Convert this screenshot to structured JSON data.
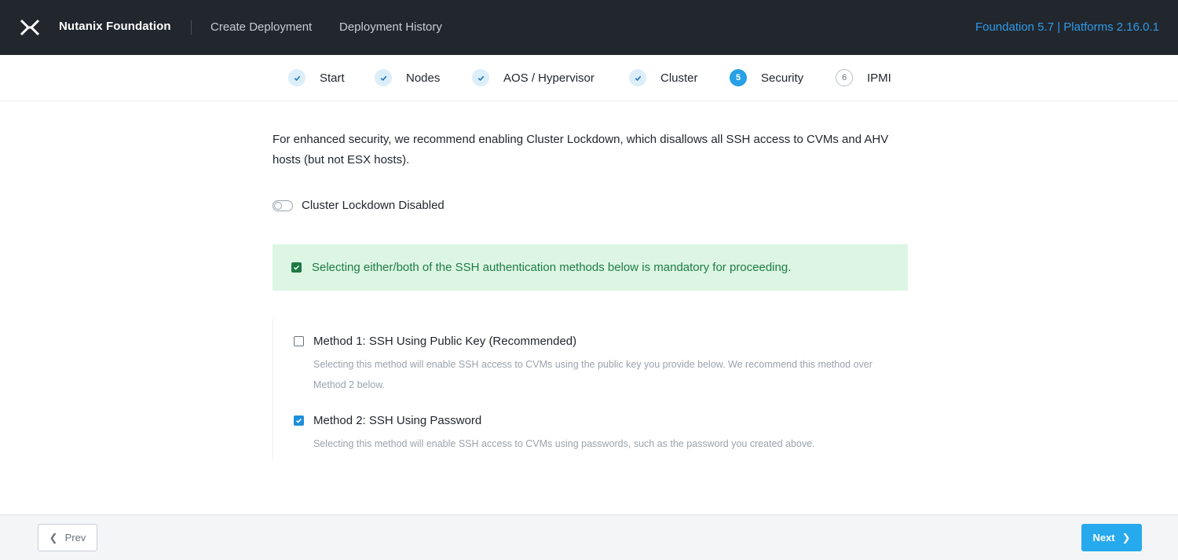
{
  "header": {
    "logo_icon": "nutanix-x-logo-icon",
    "brand": "Nutanix Foundation",
    "nav": {
      "create": "Create Deployment",
      "history": "Deployment History"
    },
    "version": "Foundation 5.7 | Platforms 2.16.0.1"
  },
  "steps": [
    {
      "label": "Start",
      "state": "done",
      "marker": ""
    },
    {
      "label": "Nodes",
      "state": "done",
      "marker": ""
    },
    {
      "label": "AOS / Hypervisor",
      "state": "done",
      "marker": ""
    },
    {
      "label": "Cluster",
      "state": "done",
      "marker": ""
    },
    {
      "label": "Security",
      "state": "active",
      "marker": "5"
    },
    {
      "label": "IPMI",
      "state": "todo",
      "marker": "6"
    }
  ],
  "content": {
    "intro": "For enhanced security, we recommend enabling Cluster Lockdown, which disallows all SSH access to CVMs and AHV hosts (but not ESX hosts).",
    "lockdown_toggle": {
      "label": "Cluster Lockdown Disabled",
      "on": false
    },
    "notice": "Selecting either/both of the SSH authentication methods below is mandatory for proceeding.",
    "methods": [
      {
        "title": "Method 1: SSH Using Public Key (Recommended)",
        "desc": "Selecting this method will enable SSH access to CVMs using the public key you provide below. We recommend this method over Method 2 below.",
        "checked": false
      },
      {
        "title": "Method 2: SSH Using Password",
        "desc": "Selecting this method will enable SSH access to CVMs using passwords, such as the password you created above.",
        "checked": true
      }
    ]
  },
  "footer": {
    "prev": "Prev",
    "next": "Next"
  },
  "colors": {
    "header_bg": "#22272e",
    "accent": "#27a9ee",
    "version": "#2e9be8",
    "notice_bg": "#dcf6e3",
    "notice_text": "#1f7a47"
  }
}
